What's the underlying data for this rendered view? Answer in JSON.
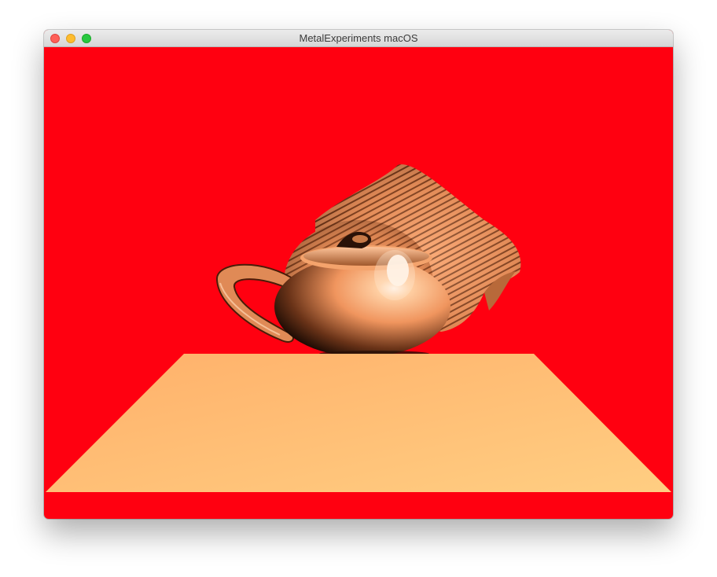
{
  "window": {
    "title": "MetalExperiments macOS"
  },
  "scene": {
    "clear_color": "#ff0010",
    "floor_color": "#ffc27a",
    "object_color": "#ffa874",
    "highlight_color": "#fff4e8"
  },
  "icons": {
    "close": "close-icon",
    "minimize": "minimize-icon",
    "zoom": "zoom-icon"
  }
}
